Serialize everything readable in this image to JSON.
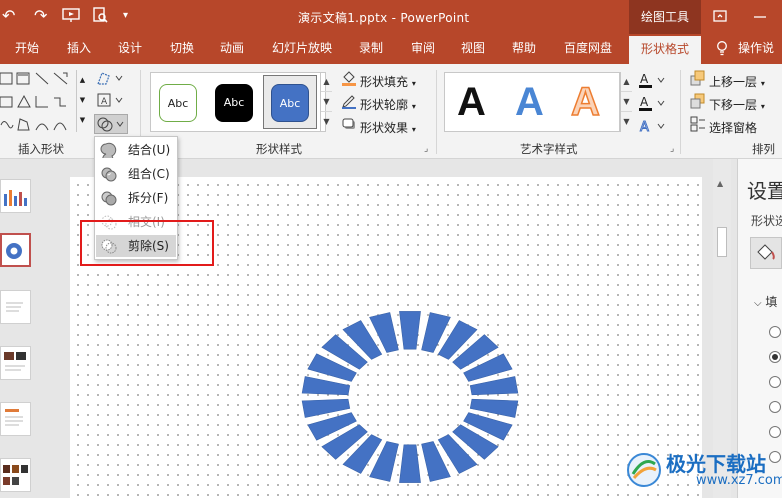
{
  "app": {
    "title": "演示文稿1.pptx - PowerPoint",
    "context_group": "绘图工具"
  },
  "tabs": [
    {
      "label": "开始"
    },
    {
      "label": "插入"
    },
    {
      "label": "设计"
    },
    {
      "label": "切换"
    },
    {
      "label": "动画"
    },
    {
      "label": "幻灯片放映"
    },
    {
      "label": "录制"
    },
    {
      "label": "审阅"
    },
    {
      "label": "视图"
    },
    {
      "label": "帮助"
    },
    {
      "label": "百度网盘"
    },
    {
      "label": "形状格式",
      "active": true
    },
    {
      "label": "操作说"
    }
  ],
  "ribbon": {
    "groups": {
      "insert_shapes": "插入形状",
      "shape_styles": "形状样式",
      "wordart_styles": "艺术字样式",
      "arrange": "排列"
    },
    "style_samples": [
      "Abc",
      "Abc",
      "Abc"
    ],
    "shape_fill": "形状填充",
    "shape_outline": "形状轮廓",
    "shape_effects": "形状效果",
    "wordart_samples": [
      "A",
      "A",
      "A"
    ],
    "bring_forward": "上移一层",
    "send_backward": "下移一层",
    "selection_pane": "选择窗格"
  },
  "merge_menu": {
    "items": [
      {
        "label": "结合(U)",
        "state": "enabled"
      },
      {
        "label": "组合(C)",
        "state": "enabled"
      },
      {
        "label": "拆分(F)",
        "state": "enabled"
      },
      {
        "label": "相交(I)",
        "state": "disabled"
      },
      {
        "label": "剪除(S)",
        "state": "highlighted"
      }
    ]
  },
  "format_pane": {
    "title": "设置",
    "subtitle": "形状选",
    "section": "填"
  },
  "watermark": {
    "text": "极光下载站",
    "url": "www.xz7.com"
  },
  "colors": {
    "title_bar": "#b7472a",
    "shape_fill": "#4472c4",
    "highlight_rect": "#e21b1b"
  }
}
